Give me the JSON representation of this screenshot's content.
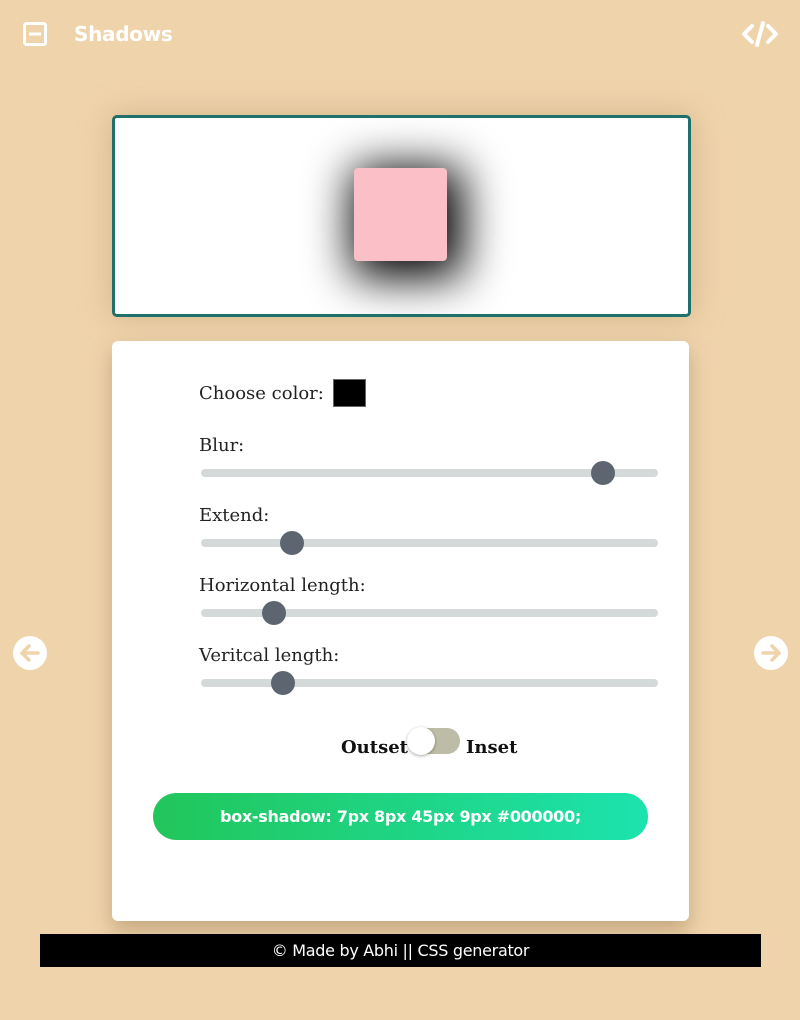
{
  "header": {
    "title": "Shadows",
    "menu_icon": "collapse-square-icon",
    "code_icon": "code-icon"
  },
  "preview": {
    "square_color": "#fbc0c7",
    "border_color": "#1f6f6a"
  },
  "controls": {
    "color_label": "Choose color:",
    "color_value": "#000000",
    "sliders": [
      {
        "label": "Blur:",
        "value_fraction": 0.88
      },
      {
        "label": "Extend:",
        "value_fraction": 0.2
      },
      {
        "label": "Horizontal length:",
        "value_fraction": 0.16
      },
      {
        "label": "Veritcal length:",
        "value_fraction": 0.18
      }
    ],
    "toggle": {
      "left_label": "Outset",
      "right_label": "Inset",
      "state": "Outset"
    },
    "output": "box-shadow: 7px 8px 45px 9px #000000;"
  },
  "nav": {
    "prev_icon": "arrow-left-circle-icon",
    "next_icon": "arrow-right-circle-icon"
  },
  "footer": {
    "text": "© Made by Abhi || CSS generator"
  },
  "colors": {
    "background": "#efd3ab",
    "slider_thumb": "#5d6670",
    "slider_track": "#d4d9d9",
    "gradient_start": "#21c65a",
    "gradient_end": "#1ce3ae"
  }
}
